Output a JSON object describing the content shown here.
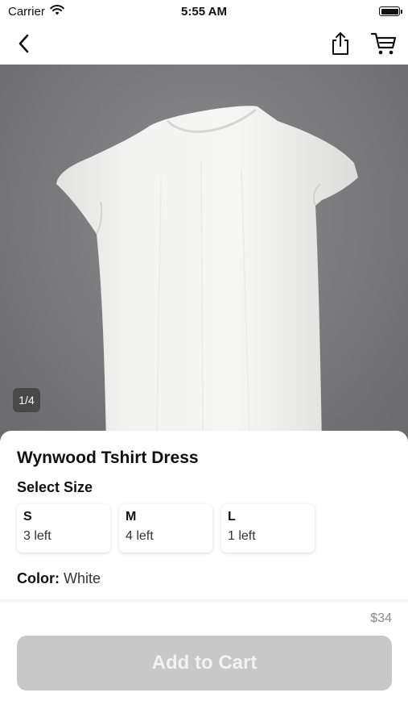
{
  "status_bar": {
    "carrier": "Carrier",
    "time": "5:55 AM"
  },
  "nav": {
    "back_icon": "chevron-left-icon",
    "share_icon": "share-icon",
    "cart_icon": "cart-icon"
  },
  "product": {
    "image_index": "1/4",
    "title": "Wynwood Tshirt Dress",
    "size_heading": "Select Size",
    "sizes": [
      {
        "name": "S",
        "stock": "3 left"
      },
      {
        "name": "M",
        "stock": "4 left"
      },
      {
        "name": "L",
        "stock": "1 left"
      }
    ],
    "color_label": "Color:",
    "color_value": "White",
    "price": "$34"
  },
  "actions": {
    "add_to_cart_label": "Add to Cart",
    "add_to_cart_color": "#c8c8c8"
  }
}
